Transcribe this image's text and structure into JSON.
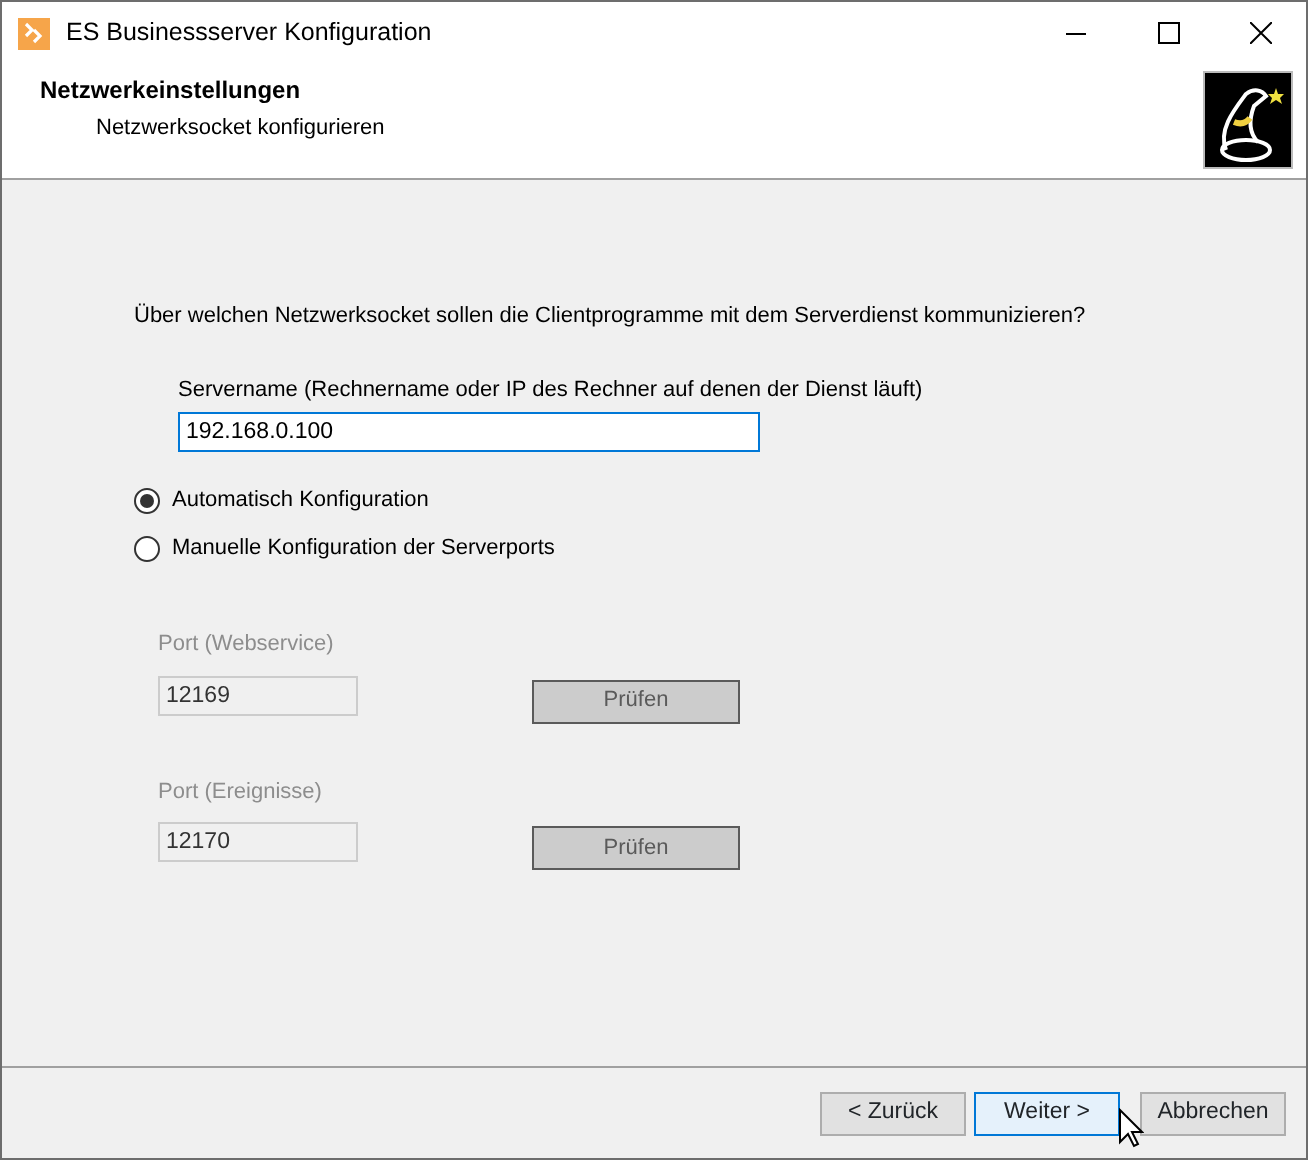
{
  "window": {
    "title": "ES Businessserver Konfiguration"
  },
  "header": {
    "title": "Netzwerkeinstellungen",
    "subtitle": "Netzwerksocket konfigurieren"
  },
  "question": "Über welchen Netzwerksocket sollen die Clientprogramme mit dem Serverdienst kommunizieren?",
  "server": {
    "label": "Servername (Rechnername oder IP des Rechner auf denen der Dienst läuft)",
    "value": "192.168.0.100"
  },
  "modes": [
    {
      "label": "Automatisch Konfiguration",
      "selected": true
    },
    {
      "label": "Manuelle Konfiguration der Serverports",
      "selected": false
    }
  ],
  "ports": [
    {
      "label": "Port (Webservice)",
      "value": "12169",
      "button": "Prüfen",
      "disabled": true
    },
    {
      "label": "Port (Ereignisse)",
      "value": "12170",
      "button": "Prüfen",
      "disabled": true
    }
  ],
  "buttons": [
    {
      "label": "< Zurück",
      "hovered": false
    },
    {
      "label": "Weiter >",
      "hovered": true
    },
    {
      "label": "Abbrechen",
      "hovered": false
    }
  ]
}
